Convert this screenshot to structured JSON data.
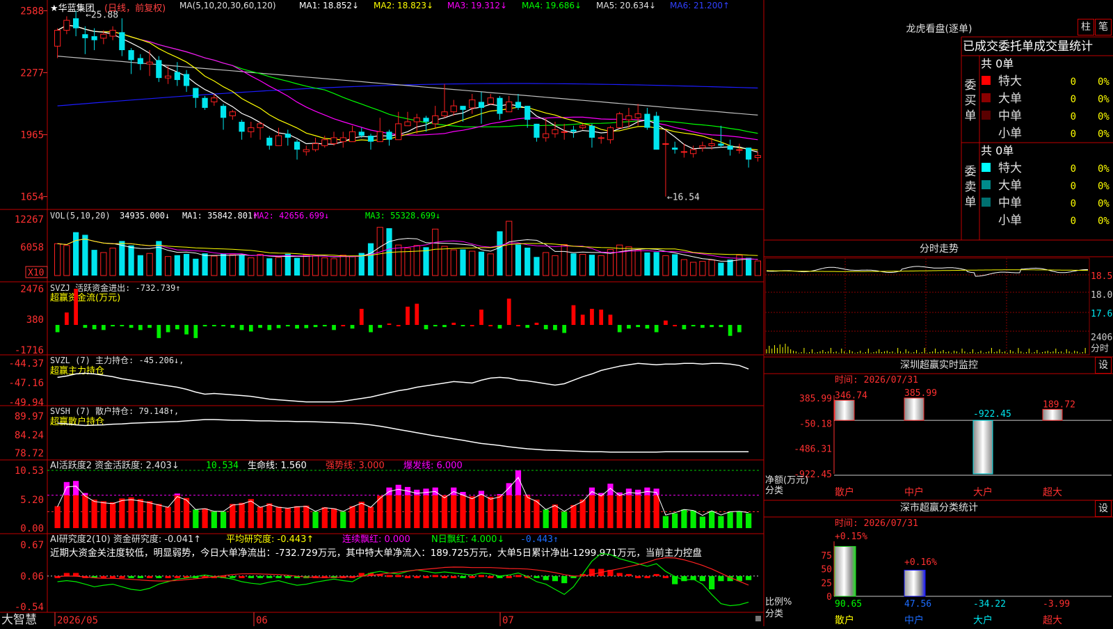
{
  "colors": {
    "up": "#ff2020",
    "down": "#00e5ee",
    "grid": "#8b0000",
    "axis": "#c00000",
    "ma1": "#ffffff",
    "ma2": "#ffff00",
    "ma3": "#ff00ff",
    "ma4": "#00ff00",
    "ma5": "#c0c0c0",
    "ma6": "#1c1cff"
  },
  "header": {
    "stock": "★华蓝集团",
    "period": "(日线，前复权)",
    "ma_prefix": "MA(5,10,20,30,60,120)",
    "ma1": "MA1: 18.852↓",
    "ma2": "MA2: 18.823↓",
    "ma3": "MA3: 19.312↓",
    "ma4": "MA4: 19.686↓",
    "ma5": "MA5: 20.634↓",
    "ma6": "MA6: 21.200↑"
  },
  "price_axis": [
    "2588",
    "2277",
    "1965",
    "1654"
  ],
  "price_marks": {
    "high": "25.88",
    "low": "16.54"
  },
  "vol": {
    "title": "VOL(5,10,20)",
    "value": "34935.000↓",
    "ma1": "MA1: 35842.801↑",
    "ma2": "MA2: 42656.699↓",
    "ma3": "MA3: 55328.699↓",
    "axis": [
      "12267",
      "6058"
    ],
    "unit": "X10"
  },
  "svzj": {
    "title": "SVZJ  活跃资金进出: -732.739↑",
    "sub": "超赢资金流(万元)",
    "axis": [
      "2476",
      "380",
      "-1716"
    ]
  },
  "svzl": {
    "title": "SVZL (7) 主力持仓: -45.206↓,",
    "sub": "超赢主力持仓",
    "axis": [
      "-44.37",
      "-47.16",
      "-49.94"
    ]
  },
  "svsh": {
    "title": "SVSH (7) 散户持仓: 79.148↑,",
    "sub": "超赢散户持仓",
    "axis": [
      "89.97",
      "84.24",
      "78.72"
    ]
  },
  "ai2": {
    "a": "AI活跃度2 资金活跃度: 2.403↓",
    "b": "10.534",
    "c": "生命线: 1.560",
    "d": "强势线: 3.000",
    "e": "爆发线: 6.000",
    "axis": [
      "10.53",
      "5.20",
      "0.00"
    ]
  },
  "ai_res": {
    "a": "AI研究度2(10) 资金研究度: -0.041↑",
    "b": "平均研究度: -0.443↑",
    "c": "连续飘红: 0.000",
    "d": "N日飘红: 4.000↓",
    "e": "-0.443↑",
    "desc": "近期大资金关注度较低，明显弱势，今日大单净流出：-732.729万元，其中特大单净流入：189.725万元，大单5日累计净出-1299.971万元，当前主力控盘",
    "axis": [
      "0.67",
      "0.06",
      "-0.54"
    ]
  },
  "bottom": {
    "brand": "大智慧",
    "dates": [
      "2026/05",
      "06",
      "07"
    ]
  },
  "dragon": {
    "title": "龙虎看盘(逐单)",
    "btn1": "柱",
    "btn2": "笔",
    "tabs": "已成交委托单成交量统计",
    "buy_label": "委买单",
    "sell_label": "委卖单",
    "buy_total": "共 0单",
    "sell_total": "共 0单",
    "buy_rows": [
      {
        "name": "特大",
        "count": "0",
        "pct": "0%",
        "color": "#ff0000"
      },
      {
        "name": "大单",
        "count": "0",
        "pct": "0%",
        "color": "#8b0000"
      },
      {
        "name": "中单",
        "count": "0",
        "pct": "0%",
        "color": "#5a0000"
      },
      {
        "name": "小单",
        "count": "0",
        "pct": "0%",
        "color": "#000000"
      }
    ],
    "sell_rows": [
      {
        "name": "特大",
        "count": "0",
        "pct": "0%",
        "color": "#00ffff"
      },
      {
        "name": "大单",
        "count": "0",
        "pct": "0%",
        "color": "#008b8b"
      },
      {
        "name": "中单",
        "count": "0",
        "pct": "0%",
        "color": "#007070"
      },
      {
        "name": "小单",
        "count": "0",
        "pct": "0%",
        "color": "#000000"
      }
    ]
  },
  "intraday": {
    "title": "分时走势",
    "axis": [
      "18.51",
      "18.06",
      "17.61"
    ],
    "vol": "2406",
    "vol_label": "分时"
  },
  "monitor": {
    "title": "深圳超赢实时监控",
    "btn": "设",
    "time": "时间: 2026/07/31",
    "axis": [
      "385.99",
      "-50.18",
      "-486.31",
      "-922.45"
    ],
    "left_label1": "净额(万元)",
    "left_label2": "分类",
    "bars": [
      {
        "name": "散户",
        "value": 346.74,
        "label": "346.74"
      },
      {
        "name": "中户",
        "value": 385.99,
        "label": "385.99"
      },
      {
        "name": "大户",
        "value": -922.45,
        "label": "-922.45"
      },
      {
        "name": "超大",
        "value": 189.72,
        "label": "189.72"
      }
    ]
  },
  "classify": {
    "title": "深市超赢分类统计",
    "btn": "设",
    "time": "时间: 2026/07/31",
    "axis": [
      "75",
      "50",
      "25",
      "0"
    ],
    "left_label1": "比例%",
    "left_label2": "分类",
    "top_labels": [
      "+0.15%",
      "+0.16%"
    ],
    "bars": [
      {
        "name": "散户",
        "value": 90.65,
        "label": "90.65"
      },
      {
        "name": "中户",
        "value": 47.56,
        "label": "47.56"
      },
      {
        "name": "大户",
        "value": -34.22,
        "label": "-34.22"
      },
      {
        "name": "超大",
        "value": -3.99,
        "label": "-3.99"
      }
    ]
  },
  "chart_data": {
    "type": "candlestick",
    "candles": [
      [
        24.1,
        24.9,
        23.5,
        25.0
      ],
      [
        24.9,
        25.4,
        24.7,
        25.6
      ],
      [
        25.5,
        25.0,
        24.6,
        25.88
      ],
      [
        24.7,
        24.5,
        23.7,
        25.1
      ],
      [
        24.6,
        24.4,
        23.9,
        25.0
      ],
      [
        24.5,
        24.7,
        24.2,
        24.9
      ],
      [
        24.6,
        24.9,
        24.4,
        25.1
      ],
      [
        24.8,
        23.9,
        23.6,
        25.5
      ],
      [
        23.9,
        23.4,
        22.7,
        24.0
      ],
      [
        23.5,
        23.2,
        22.9,
        23.7
      ],
      [
        23.2,
        23.3,
        22.6,
        23.9
      ],
      [
        23.4,
        22.5,
        22.3,
        23.6
      ],
      [
        22.5,
        22.6,
        22.2,
        23.1
      ],
      [
        22.8,
        22.4,
        22.1,
        23.3
      ],
      [
        22.7,
        22.1,
        21.8,
        22.9
      ],
      [
        22.0,
        21.5,
        21.0,
        22.0
      ],
      [
        21.5,
        21.0,
        20.9,
        21.6
      ],
      [
        21.3,
        21.5,
        21.1,
        21.7
      ],
      [
        21.1,
        20.5,
        19.9,
        21.2
      ],
      [
        20.6,
        20.8,
        20.4,
        20.9
      ],
      [
        20.3,
        19.8,
        19.4,
        20.4
      ],
      [
        19.8,
        20.0,
        19.5,
        20.3
      ],
      [
        20.0,
        20.2,
        19.4,
        20.3
      ],
      [
        19.5,
        19.1,
        18.9,
        19.6
      ],
      [
        19.1,
        19.6,
        19.2,
        20.0
      ],
      [
        19.7,
        19.5,
        19.1,
        19.9
      ],
      [
        19.3,
        18.9,
        18.4,
        19.4
      ],
      [
        18.8,
        18.9,
        18.6,
        19.1
      ],
      [
        18.9,
        19.2,
        18.8,
        19.5
      ],
      [
        19.1,
        19.4,
        19.0,
        19.6
      ],
      [
        19.2,
        19.5,
        19.1,
        19.8
      ],
      [
        19.3,
        19.5,
        19.0,
        19.8
      ],
      [
        19.3,
        19.8,
        19.3,
        20.1
      ],
      [
        19.8,
        19.6,
        19.5,
        20.0
      ],
      [
        19.6,
        19.3,
        18.9,
        19.7
      ],
      [
        19.3,
        19.8,
        19.4,
        20.5
      ],
      [
        19.8,
        19.4,
        19.1,
        19.9
      ],
      [
        19.4,
        20.2,
        19.6,
        20.8
      ],
      [
        20.1,
        20.3,
        20.2,
        20.8
      ],
      [
        20.3,
        20.5,
        19.7,
        20.7
      ],
      [
        20.5,
        20.3,
        19.8,
        20.6
      ],
      [
        20.2,
        20.6,
        20.0,
        21.1
      ],
      [
        20.6,
        20.8,
        20.5,
        22.2
      ],
      [
        20.8,
        21.1,
        20.6,
        21.4
      ],
      [
        21.1,
        20.9,
        20.3,
        21.1
      ],
      [
        21.0,
        21.4,
        20.7,
        21.7
      ],
      [
        21.3,
        21.0,
        20.2,
        21.8
      ],
      [
        21.2,
        21.5,
        21.2,
        21.7
      ],
      [
        21.5,
        20.7,
        20.4,
        21.6
      ],
      [
        20.8,
        21.3,
        20.8,
        21.6
      ],
      [
        21.3,
        21.0,
        20.9,
        21.7
      ],
      [
        21.1,
        20.4,
        20.0,
        21.1
      ],
      [
        20.2,
        19.5,
        19.3,
        20.2
      ],
      [
        19.5,
        19.7,
        19.3,
        20.5
      ],
      [
        19.7,
        19.9,
        19.5,
        20.3
      ],
      [
        19.8,
        19.8,
        19.4,
        20.2
      ],
      [
        19.9,
        19.8,
        19.5,
        20.1
      ],
      [
        20.0,
        20.1,
        19.9,
        20.2
      ],
      [
        20.1,
        19.5,
        19.0,
        20.2
      ],
      [
        19.5,
        19.5,
        19.2,
        19.6
      ],
      [
        19.4,
        20.0,
        19.2,
        20.1
      ],
      [
        20.0,
        20.7,
        20.0,
        20.8
      ],
      [
        20.4,
        20.6,
        20.0,
        21.0
      ],
      [
        20.5,
        20.7,
        20.1,
        21.2
      ],
      [
        20.7,
        20.0,
        19.9,
        21.0
      ],
      [
        20.6,
        18.9,
        18.9,
        20.8
      ],
      [
        19.2,
        19.2,
        16.54,
        19.9
      ],
      [
        19.0,
        18.9,
        18.7,
        19.3
      ],
      [
        18.8,
        18.8,
        18.5,
        19.2
      ],
      [
        18.7,
        18.9,
        18.5,
        19.1
      ],
      [
        19.0,
        19.1,
        18.8,
        19.3
      ],
      [
        19.1,
        19.2,
        18.9,
        19.5
      ],
      [
        19.2,
        19.1,
        19.0,
        20.1
      ],
      [
        19.1,
        18.9,
        18.6,
        19.4
      ],
      [
        18.9,
        18.9,
        18.7,
        19.2
      ],
      [
        19.0,
        18.4,
        18.0,
        19.0
      ],
      [
        18.5,
        18.6,
        18.3,
        18.8
      ]
    ],
    "vol": [
      7200,
      6800,
      9800,
      9200,
      5800,
      5200,
      6200,
      7800,
      6800,
      4600,
      5000,
      7800,
      4300,
      4600,
      4900,
      3800,
      5000,
      4400,
      4900,
      4700,
      4600,
      4000,
      4800,
      3900,
      4100,
      4900,
      4000,
      4700,
      4500,
      4000,
      3800,
      4600,
      4400,
      5100,
      7300,
      10900,
      10700,
      6900,
      6200,
      6800,
      6400,
      10500,
      6600,
      5800,
      5900,
      5500,
      5400,
      4900,
      10000,
      12267,
      7000,
      6300,
      4200,
      5200,
      4500,
      7000,
      5000,
      4800,
      4700,
      4500,
      5900,
      6900,
      6500,
      5800,
      5200,
      5300,
      4500,
      4800,
      3600,
      3000,
      3200,
      3500,
      2900,
      3600,
      4600,
      4000,
      3300
    ],
    "svzj": [
      -500,
      850,
      2476,
      -200,
      -300,
      -350,
      -100,
      -50,
      -200,
      -350,
      -200,
      -900,
      -500,
      -300,
      -650,
      -900,
      -100,
      -20,
      -100,
      -200,
      -350,
      -450,
      -200,
      -350,
      -220,
      -100,
      -250,
      -220,
      -150,
      -100,
      -350,
      0,
      -250,
      1100,
      -500,
      -200,
      100,
      0,
      1250,
      1450,
      -300,
      -100,
      -150,
      150,
      -20,
      0,
      1050,
      0,
      -250,
      1800,
      0,
      -200,
      150,
      -300,
      -350,
      -550,
      1350,
      700,
      1100,
      1050,
      700,
      -500,
      -250,
      -150,
      -250,
      -500,
      300,
      0,
      -300,
      -100,
      -200,
      -150,
      -150,
      -750,
      -500
    ],
    "svzl": [
      -46.4,
      -46.2,
      -45.9,
      -45.8,
      -45.9,
      -46.1,
      -46.3,
      -46.6,
      -46.8,
      -47.0,
      -47.2,
      -47.4,
      -47.6,
      -47.8,
      -48.1,
      -48.5,
      -48.8,
      -48.7,
      -48.8,
      -48.9,
      -49.0,
      -49.1,
      -49.3,
      -49.5,
      -49.6,
      -49.7,
      -49.8,
      -49.9,
      -49.9,
      -49.9,
      -49.9,
      -49.8,
      -49.6,
      -49.4,
      -49.2,
      -48.9,
      -48.6,
      -48.3,
      -48.1,
      -47.8,
      -47.6,
      -47.4,
      -47.2,
      -47.0,
      -47.1,
      -47.2,
      -46.8,
      -46.5,
      -46.4,
      -46.5,
      -46.8,
      -46.9,
      -47.1,
      -47.3,
      -47.5,
      -47.3,
      -46.8,
      -46.3,
      -45.9,
      -45.4,
      -45.1,
      -44.8,
      -44.6,
      -44.4,
      -44.5,
      -44.6,
      -44.5,
      -44.5,
      -44.4,
      -44.4,
      -44.5,
      -44.4,
      -44.4,
      -44.5,
      -44.7,
      -45.2
    ],
    "svsh": [
      87.8,
      87.6,
      87.3,
      87.1,
      87.2,
      87.3,
      87.5,
      87.6,
      87.8,
      87.9,
      88.0,
      88.1,
      88.2,
      88.3,
      88.5,
      88.7,
      88.9,
      88.9,
      88.8,
      88.7,
      88.7,
      88.6,
      88.5,
      88.5,
      88.4,
      88.4,
      88.3,
      88.3,
      88.2,
      88.1,
      88.0,
      87.9,
      87.8,
      87.6,
      87.3,
      86.9,
      86.4,
      85.9,
      85.4,
      84.9,
      84.4,
      83.9,
      83.5,
      83.0,
      82.6,
      82.1,
      81.6,
      81.3,
      81.0,
      80.6,
      80.3,
      80.0,
      79.8,
      79.6,
      79.5,
      79.4,
      79.3,
      79.2,
      79.1,
      79.1,
      79.0,
      79.0,
      79.0,
      79.0,
      79.0,
      79.0,
      79.1,
      79.1,
      79.1,
      79.1,
      79.1,
      79.1,
      79.1,
      79.1,
      79.1,
      79.1
    ],
    "ai2": [
      4.0,
      8.4,
      8.6,
      6.4,
      5.2,
      4.9,
      4.7,
      5.4,
      5.6,
      5.3,
      4.9,
      4.4,
      3.9,
      6.3,
      5.5,
      3.4,
      3.6,
      3.0,
      3.0,
      4.4,
      4.6,
      5.3,
      3.9,
      4.5,
      3.9,
      3.7,
      4.0,
      4.1,
      3.0,
      3.8,
      3.6,
      3.0,
      4.0,
      4.8,
      3.9,
      5.9,
      7.4,
      7.9,
      7.5,
      7.0,
      7.2,
      7.4,
      6.0,
      7.4,
      6.6,
      5.8,
      6.8,
      5.7,
      6.2,
      8.2,
      10.53,
      6.1,
      5.2,
      3.4,
      4.3,
      3.0,
      4.2,
      5.2,
      7.4,
      6.4,
      8.1,
      6.5,
      7.2,
      7.0,
      7.4,
      7.2,
      2.2,
      2.7,
      3.4,
      3.2,
      2.1,
      3.1,
      2.2,
      2.9,
      3.0,
      2.7
    ],
    "ai_res": [
      0.06,
      0.12,
      0.12,
      0.06,
      0.04,
      0.06,
      0.06,
      0.06,
      0.02,
      0.02,
      0.06,
      0.04,
      0.06,
      0.06,
      0.06,
      0.04,
      0.06,
      0.06,
      0.06,
      0.02,
      0.06,
      0.04,
      0.04,
      0.02,
      0.02,
      0.04,
      0.04,
      0.02,
      0.06,
      0.06,
      0.04,
      0.06,
      0.06,
      0.12,
      0.12,
      0.1,
      0.08,
      0.08,
      0.06,
      0.06,
      0.06,
      0.08,
      0.06,
      0.06,
      0.04,
      0.06,
      0.08,
      0.06,
      0.04,
      0.06,
      0.08,
      0.06,
      0.02,
      -0.02,
      -0.04,
      -0.08,
      0.02,
      0.1,
      0.2,
      0.2,
      0.18,
      0.12,
      0.1,
      0.06,
      0.06,
      0.1,
      0.06,
      -0.1,
      -0.04,
      -0.02,
      -0.04,
      -0.2,
      -0.04,
      -0.04,
      -0.04,
      -0.02
    ],
    "axes": {
      "price_ylim": [
        16,
        26
      ],
      "vol_ylim": [
        0,
        12267
      ],
      "svzj_ylim": [
        -1716,
        2476
      ],
      "svzl_ylim": [
        -49.94,
        -44.37
      ],
      "svsh_ylim": [
        78.72,
        89.97
      ],
      "ai2_ylim": [
        0,
        10.53
      ],
      "ai_res_ylim": [
        -0.54,
        0.67
      ]
    }
  }
}
